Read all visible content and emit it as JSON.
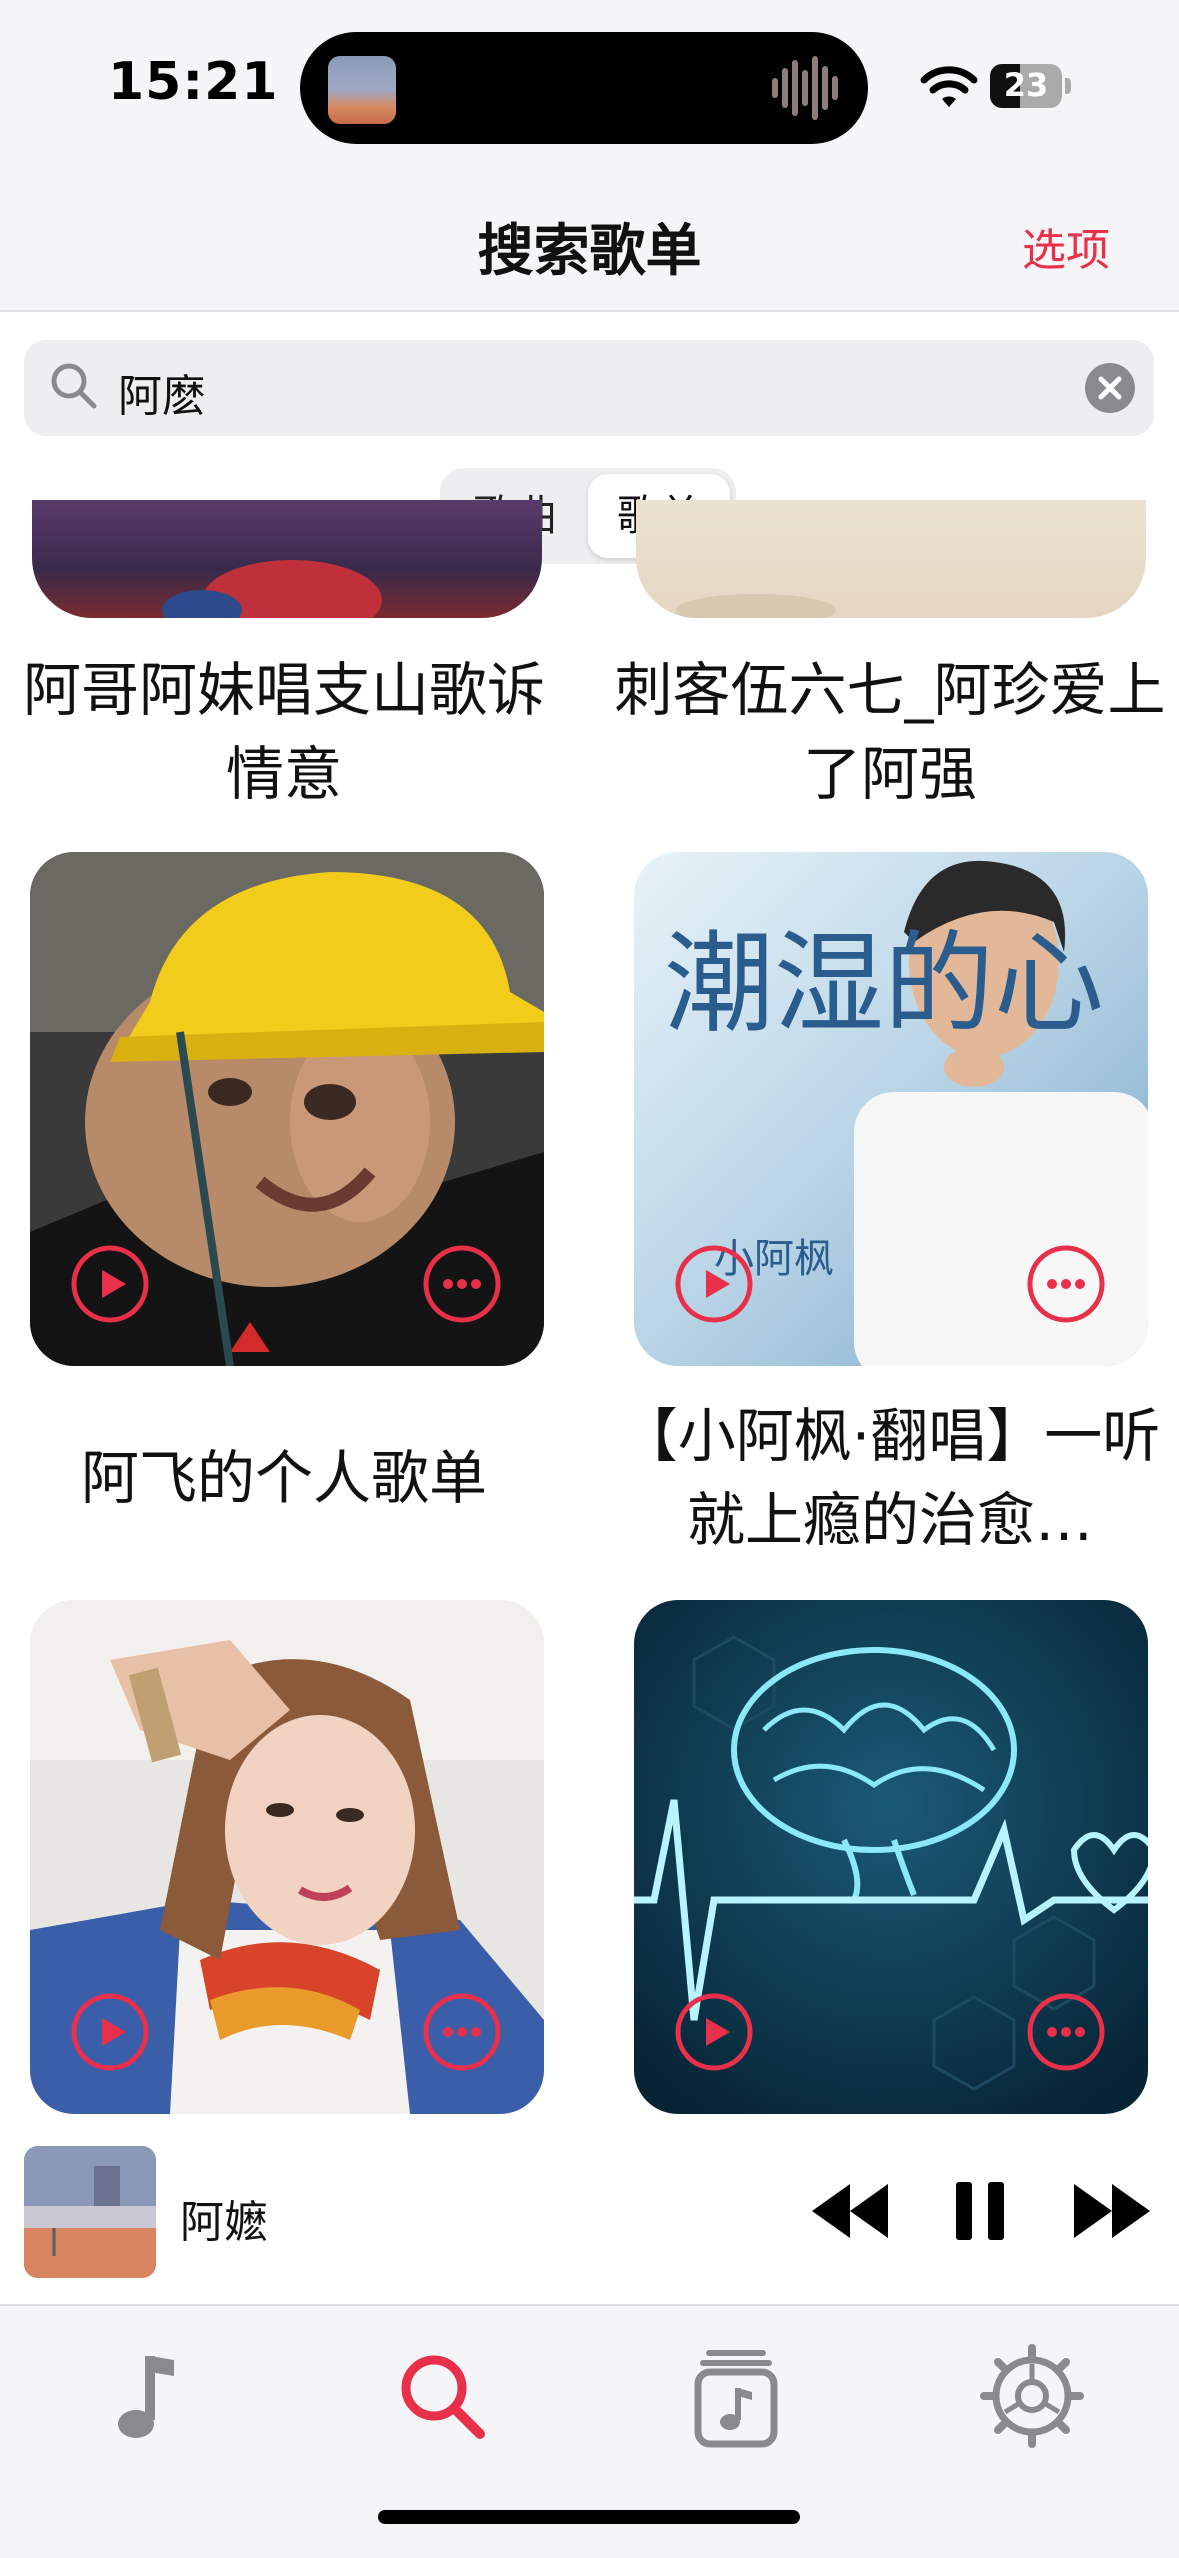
{
  "status_bar": {
    "time": "15:21",
    "battery": "23"
  },
  "nav": {
    "title": "搜索歌单",
    "options_label": "选项"
  },
  "search": {
    "value": "阿麽"
  },
  "segments": {
    "songs": "歌曲",
    "playlists": "歌单",
    "selected": "歌单"
  },
  "playlists": [
    {
      "title": "阿哥阿妹唱支山歌诉情意"
    },
    {
      "title": "刺客伍六七_阿珍爱上了阿强"
    },
    {
      "title": "阿飞的个人歌单"
    },
    {
      "title": "【小阿枫·翻唱】一听就上瘾的治愈…"
    },
    {
      "title": ""
    },
    {
      "title": ""
    }
  ],
  "cover_texts": {
    "album_big": "潮湿的心",
    "album_small": "小阿枫"
  },
  "mini_player": {
    "title": "阿嬷",
    "state": "playing"
  },
  "tabs": [
    {
      "name": "library",
      "icon": "music-note-icon",
      "active": false
    },
    {
      "name": "search",
      "icon": "search-icon",
      "active": true
    },
    {
      "name": "playlists",
      "icon": "playlist-icon",
      "active": false
    },
    {
      "name": "settings",
      "icon": "gear-icon",
      "active": false
    }
  ],
  "colors": {
    "accent": "#e8304a",
    "inactive_icon": "#8a8a8e"
  }
}
